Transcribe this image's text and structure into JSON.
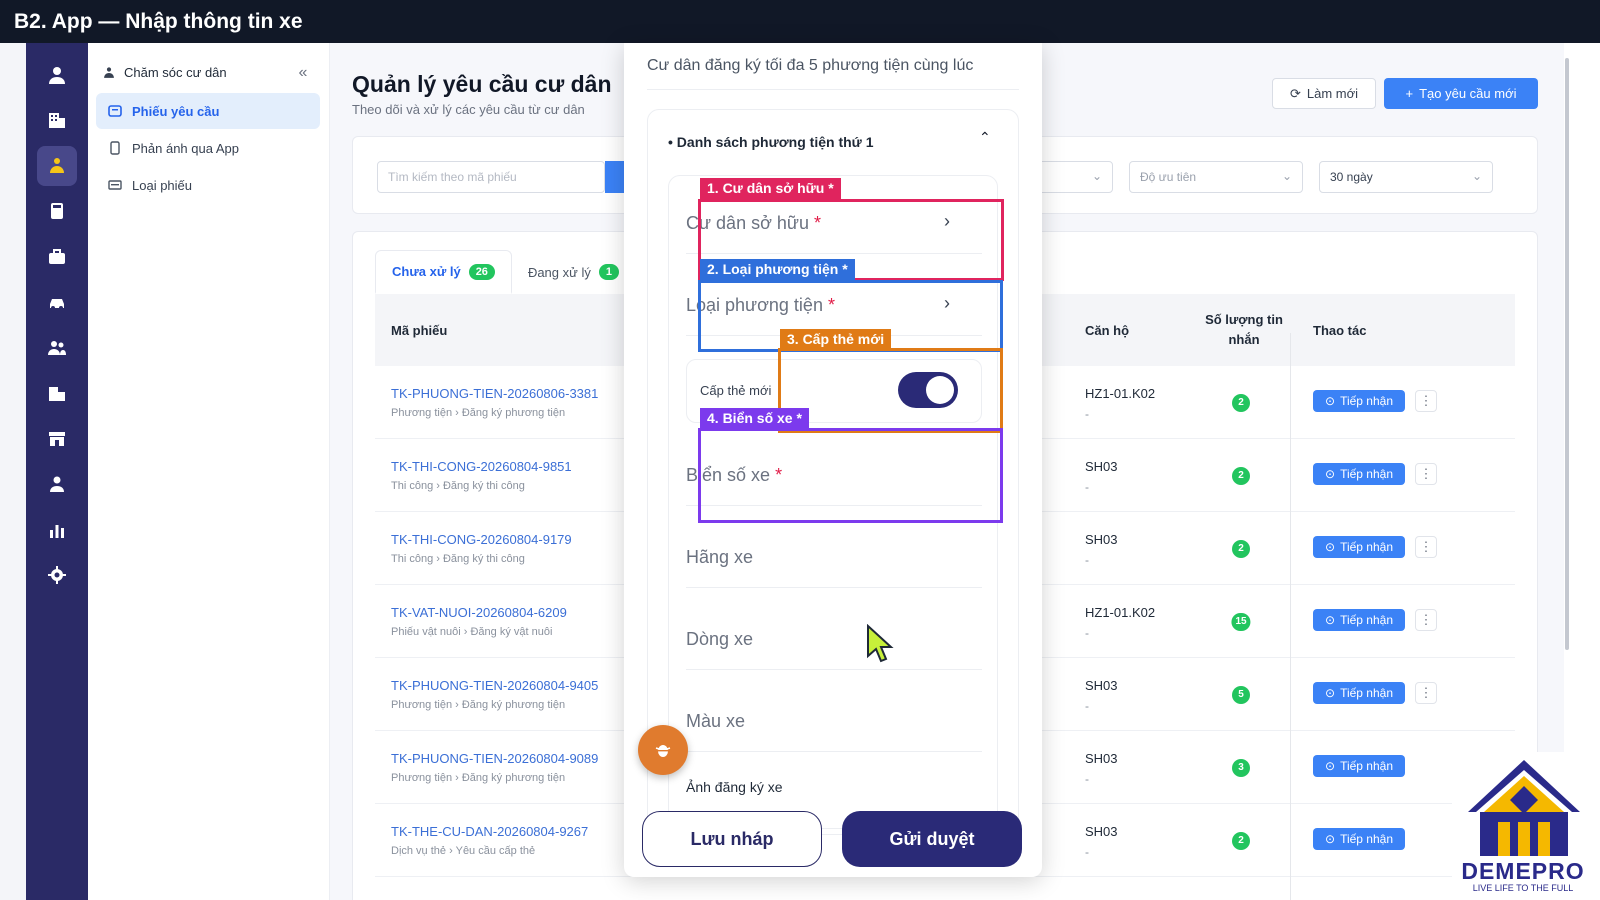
{
  "caption": "B2. App — Nhập thông tin xe",
  "sidebar": {
    "header": "Chăm sóc cư dân",
    "items": [
      {
        "label": "Phiếu yêu cầu",
        "icon": "ticket-icon",
        "active": true
      },
      {
        "label": "Phản ánh qua App",
        "icon": "phone-icon",
        "active": false
      },
      {
        "label": "Loại phiếu",
        "icon": "card-icon",
        "active": false
      }
    ]
  },
  "page": {
    "title": "Quản lý yêu cầu cư dân",
    "subtitle": "Theo dõi và xử lý các yêu cầu từ cư dân",
    "refresh_label": "Làm mới",
    "new_label": "Tạo yêu cầu mới"
  },
  "filters": {
    "search_placeholder": "Tìm kiếm theo mã phiếu",
    "priority_placeholder": "Độ ưu tiên",
    "period": "30 ngày"
  },
  "tabs": [
    {
      "label": "Chưa xử lý",
      "count": "26",
      "active": true
    },
    {
      "label": "Đang xử lý",
      "count": "1",
      "active": false
    }
  ],
  "table": {
    "headers": {
      "code": "Mã phiếu",
      "apartment": "Căn hộ",
      "messages": "Số lượng tin nhắn",
      "actions": "Thao tác"
    },
    "action_label": "Tiếp nhận",
    "rows": [
      {
        "code": "TK-PHUONG-TIEN-20260806-3381",
        "category": "Phương tiện › Đăng ký phương tiện",
        "apartment": "HZ1-01.K02",
        "apartment_sub": "-",
        "messages": "2"
      },
      {
        "code": "TK-THI-CONG-20260804-9851",
        "category": "Thi công › Đăng ký thi công",
        "apartment": "SH03",
        "apartment_sub": "-",
        "messages": "2"
      },
      {
        "code": "TK-THI-CONG-20260804-9179",
        "category": "Thi công › Đăng ký thi công",
        "apartment": "SH03",
        "apartment_sub": "-",
        "messages": "2"
      },
      {
        "code": "TK-VAT-NUOI-20260804-6209",
        "category": "Phiếu vật nuôi › Đăng ký vật nuôi",
        "apartment": "HZ1-01.K02",
        "apartment_sub": "-",
        "messages": "15"
      },
      {
        "code": "TK-PHUONG-TIEN-20260804-9405",
        "category": "Phương tiện › Đăng ký phương tiện",
        "apartment": "SH03",
        "apartment_sub": "-",
        "messages": "5"
      },
      {
        "code": "TK-PHUONG-TIEN-20260804-9089",
        "category": "Phương tiện › Đăng ký phương tiện",
        "apartment": "SH03",
        "apartment_sub": "-",
        "messages": "3"
      },
      {
        "code": "TK-THE-CU-DAN-20260804-9267",
        "category": "Dịch vụ thẻ › Yêu cầu cấp thẻ",
        "apartment": "SH03",
        "apartment_sub": "-",
        "messages": "2"
      }
    ]
  },
  "modal": {
    "note": "Cư dân đăng ký tối đa 5 phương tiện cùng lúc",
    "group_title": "• Danh sách phương tiện thứ 1",
    "owner_label": "Cư dân sở hữu",
    "vehicle_type_label": "Loại phương tiện",
    "new_card_label": "Cấp thẻ mới",
    "new_card_on": true,
    "plate_label": "Biển số xe",
    "brand_label": "Hãng xe",
    "model_label": "Dòng xe",
    "color_label": "Màu xe",
    "photo_label": "Ảnh đăng ký xe",
    "required_mark": "*",
    "draft_label": "Lưu nháp",
    "submit_label": "Gửi duyệt"
  },
  "annotations": [
    {
      "label": "1. Cư dân sở hữu *",
      "color": "#e0245e"
    },
    {
      "label": "2. Loại phương tiện *",
      "color": "#2f6fdb"
    },
    {
      "label": "3. Cấp thẻ mới",
      "color": "#e07b16"
    },
    {
      "label": "4. Biển số xe *",
      "color": "#7c3aed"
    }
  ],
  "logo": {
    "name": "DEMEPRO",
    "tagline": "LIVE LIFE TO THE FULL",
    "colors": {
      "navy": "#2a2a8a",
      "gold": "#f5b800"
    }
  },
  "colors": {
    "primary": "#3b82f6",
    "rail": "#2a2a66",
    "success": "#22c55e"
  }
}
